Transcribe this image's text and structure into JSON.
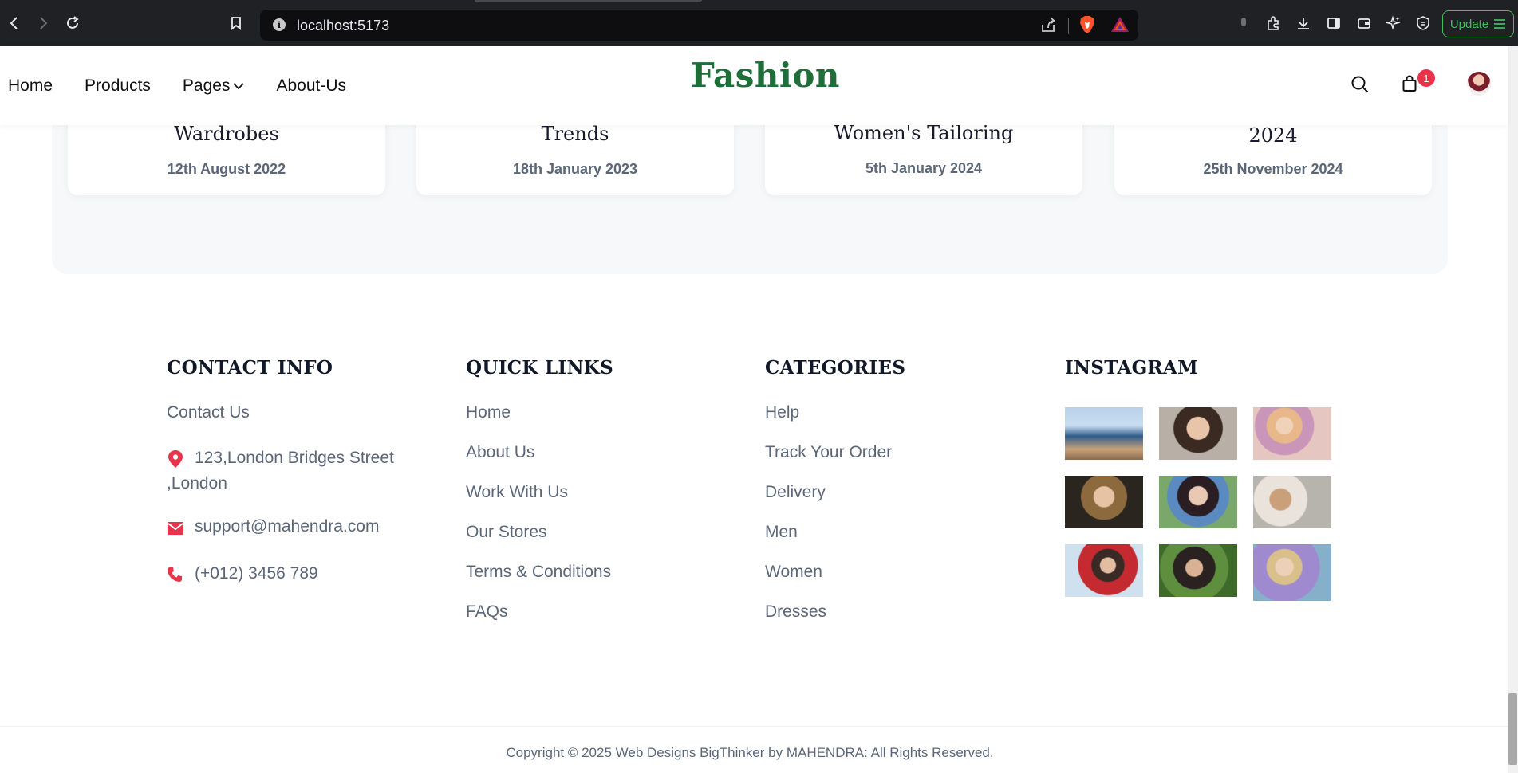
{
  "browser": {
    "url": "localhost:5173",
    "update_label": "Update",
    "icons": [
      "back-icon",
      "forward-icon",
      "reload-icon",
      "bookmark-icon",
      "info-icon",
      "share-icon",
      "brave-shield-icon",
      "brave-rewards-icon",
      "extensions-icon",
      "downloads-icon",
      "sidebar-icon",
      "wallet-icon",
      "leo-icon",
      "vpn-icon",
      "menu-icon"
    ]
  },
  "header": {
    "nav": [
      "Home",
      "Products",
      "Pages",
      "About-Us"
    ],
    "logo": "Fashion",
    "cart_count": "1"
  },
  "blog_cards": [
    {
      "title": "Wardrobes",
      "date": "12th August 2022"
    },
    {
      "title": "Trends",
      "date": "18th January 2023"
    },
    {
      "title": "Women's Tailoring",
      "date": "5th January 2024"
    },
    {
      "title": "2024",
      "date": "25th November 2024"
    }
  ],
  "footer": {
    "contact": {
      "heading": "CONTACT INFO",
      "contact_us": "Contact Us",
      "address": "123,London Bridges Street ,London",
      "email": "support@mahendra.com",
      "phone": "(+012) 3456 789"
    },
    "quick_links": {
      "heading": "QUICK LINKS",
      "items": [
        "Home",
        "About Us",
        "Work With Us",
        "Our Stores",
        "Terms & Conditions",
        "FAQs"
      ]
    },
    "categories": {
      "heading": "CATEGORIES",
      "items": [
        "Help",
        "Track Your Order",
        "Delivery",
        "Men",
        "Women",
        "Dresses"
      ]
    },
    "instagram": {
      "heading": "INSTAGRAM"
    },
    "copyright": "Copyright © 2025 Web Designs BigThinker by MAHENDRA: All Rights Reserved."
  },
  "colors": {
    "brand_green": "#1f6e3a",
    "accent_red": "#e8334a",
    "text_muted": "#5b6678",
    "update_green": "#3fbf5a"
  }
}
